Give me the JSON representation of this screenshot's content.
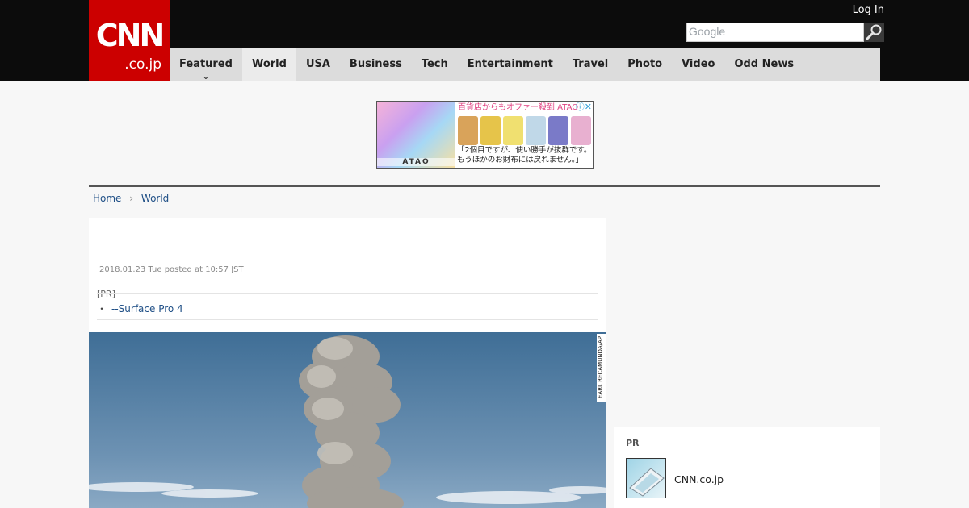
{
  "header": {
    "logo_main": "CNN",
    "logo_sub": ".co.jp",
    "login": "Log In",
    "search_placeholder": "Google"
  },
  "nav": {
    "items": [
      {
        "label": "Featured"
      },
      {
        "label": "World"
      },
      {
        "label": "USA"
      },
      {
        "label": "Business"
      },
      {
        "label": "Tech"
      },
      {
        "label": "Entertainment"
      },
      {
        "label": "Travel"
      },
      {
        "label": "Photo"
      },
      {
        "label": "Video"
      },
      {
        "label": "Odd News"
      }
    ],
    "active": "World"
  },
  "ad": {
    "headline": "百貨店からもオファー殺到 ATAO",
    "brand": "ATAO",
    "copy_line1": "「2個目ですが、使い勝手が抜群です。",
    "copy_line2": "もうほかのお財布には戻れません。」"
  },
  "breadcrumb": {
    "items": [
      "Home",
      "World"
    ]
  },
  "article": {
    "date": "2018.01.23 Tue posted at 10:57 JST",
    "pr_label": "[PR]",
    "pr_link": "--Surface Pro 4",
    "photo_credit": "EARL RECAMUNDA/AP"
  },
  "sidebar": {
    "pr_label": "PR",
    "item_name": "CNN.co.jp"
  },
  "colors": {
    "brand_red": "#cc0000",
    "topbar": "#0c0c0c",
    "nav_bg": "#dcdcdc",
    "link": "#1f4f86"
  }
}
